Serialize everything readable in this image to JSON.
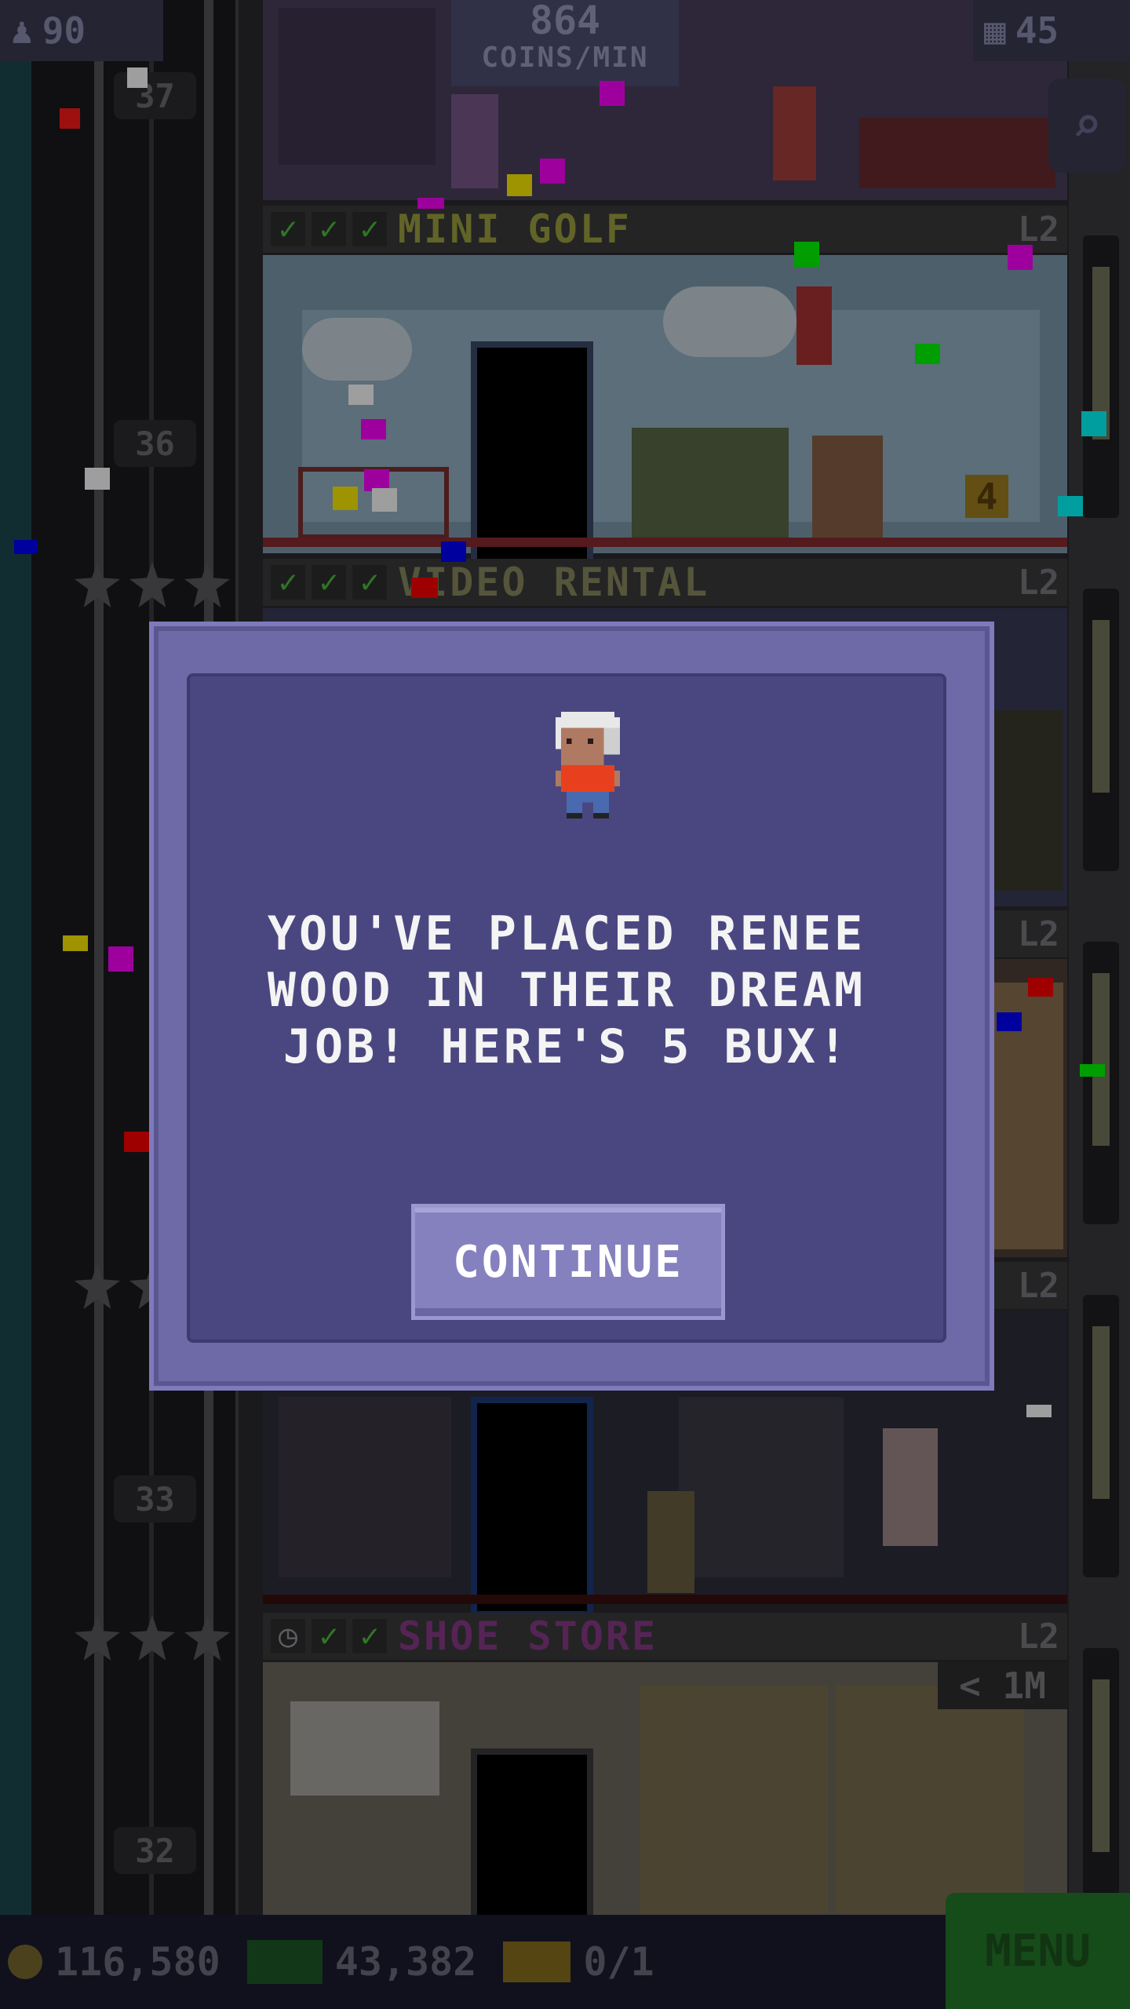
{
  "hud": {
    "population": "90",
    "coins_per_min_value": "864",
    "coins_per_min_unit": "COINS/MIN",
    "floors_count": "45"
  },
  "floor_numbers": [
    "37",
    "36",
    "33",
    "32"
  ],
  "floors": [
    {
      "name": "MINI GOLF",
      "level": "L2",
      "name_color": "#9ea040"
    },
    {
      "name": "VIDEO RENTAL",
      "level": "L2",
      "name_color": "#8a8a60"
    },
    {
      "name": "",
      "level": "L2",
      "name_color": "#8a8a60"
    },
    {
      "name": "",
      "level": "L2",
      "name_color": "#8a8a60"
    },
    {
      "name": "SHOE STORE",
      "level": "L2",
      "name_color": "#8a3a8a"
    }
  ],
  "mini_golf_hole": "4",
  "shoe_store_timer": "< 1M",
  "bottom_bar": {
    "coins": "116,580",
    "bux": "43,382",
    "tickets": "0/1",
    "menu_label": "MENU"
  },
  "dialog": {
    "message": "YOU'VE PLACED RENEE WOOD IN THEIR DREAM JOB! HERE'S 5 BUX!",
    "continue_label": "CONTINUE"
  },
  "colors": {
    "dialog_frame": "#6e6aa8",
    "dialog_body": "#4a4780",
    "button": "#8581bf",
    "menu_green": "#247a2a",
    "check_green": "#4cbf3c"
  },
  "icons": [
    "person-icon",
    "floors-icon",
    "search-icon",
    "coin-icon",
    "bux-icon",
    "ticket-icon",
    "check-icon",
    "clock-icon",
    "star-icon"
  ]
}
